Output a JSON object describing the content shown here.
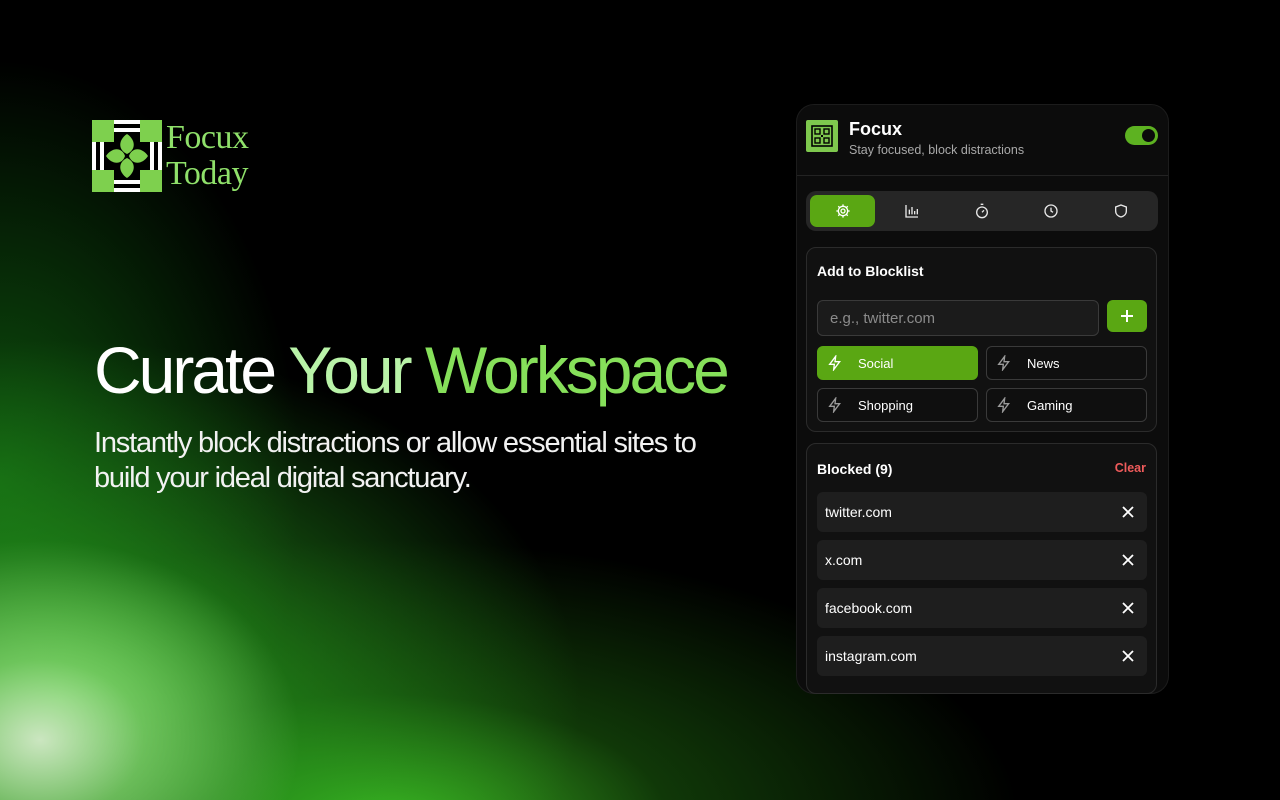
{
  "brand": {
    "logo_line1": "Focux",
    "logo_line2": "Today",
    "accent": "#86e05a"
  },
  "hero": {
    "headline_word1": "Curate",
    "headline_word2": "Your",
    "headline_word3": "Workspace",
    "subline": "Instantly block distractions or allow essential sites to build your ideal digital sanctuary."
  },
  "panel": {
    "app_name": "Focux",
    "app_subtitle": "Stay focused, block distractions",
    "master_toggle_on": true,
    "tabs": [
      {
        "icon": "gear-icon",
        "active": true
      },
      {
        "icon": "bar-chart-icon",
        "active": false
      },
      {
        "icon": "stopwatch-icon",
        "active": false
      },
      {
        "icon": "clock-icon",
        "active": false
      },
      {
        "icon": "shield-icon",
        "active": false
      }
    ],
    "add_section": {
      "title": "Add to Blocklist",
      "input_placeholder": "e.g., twitter.com",
      "input_value": "",
      "add_icon": "plus-icon",
      "categories": [
        {
          "label": "Social",
          "icon": "bolt-icon",
          "active": true
        },
        {
          "label": "News",
          "icon": "bolt-icon",
          "active": false
        },
        {
          "label": "Shopping",
          "icon": "bolt-icon",
          "active": false
        },
        {
          "label": "Gaming",
          "icon": "bolt-icon",
          "active": false
        }
      ]
    },
    "blocked_section": {
      "title": "Blocked (9)",
      "clear_label": "Clear",
      "items": [
        "twitter.com",
        "x.com",
        "facebook.com",
        "instagram.com"
      ]
    },
    "colors": {
      "primary_green": "#5aa713",
      "danger_red": "#ef5b5b"
    }
  }
}
